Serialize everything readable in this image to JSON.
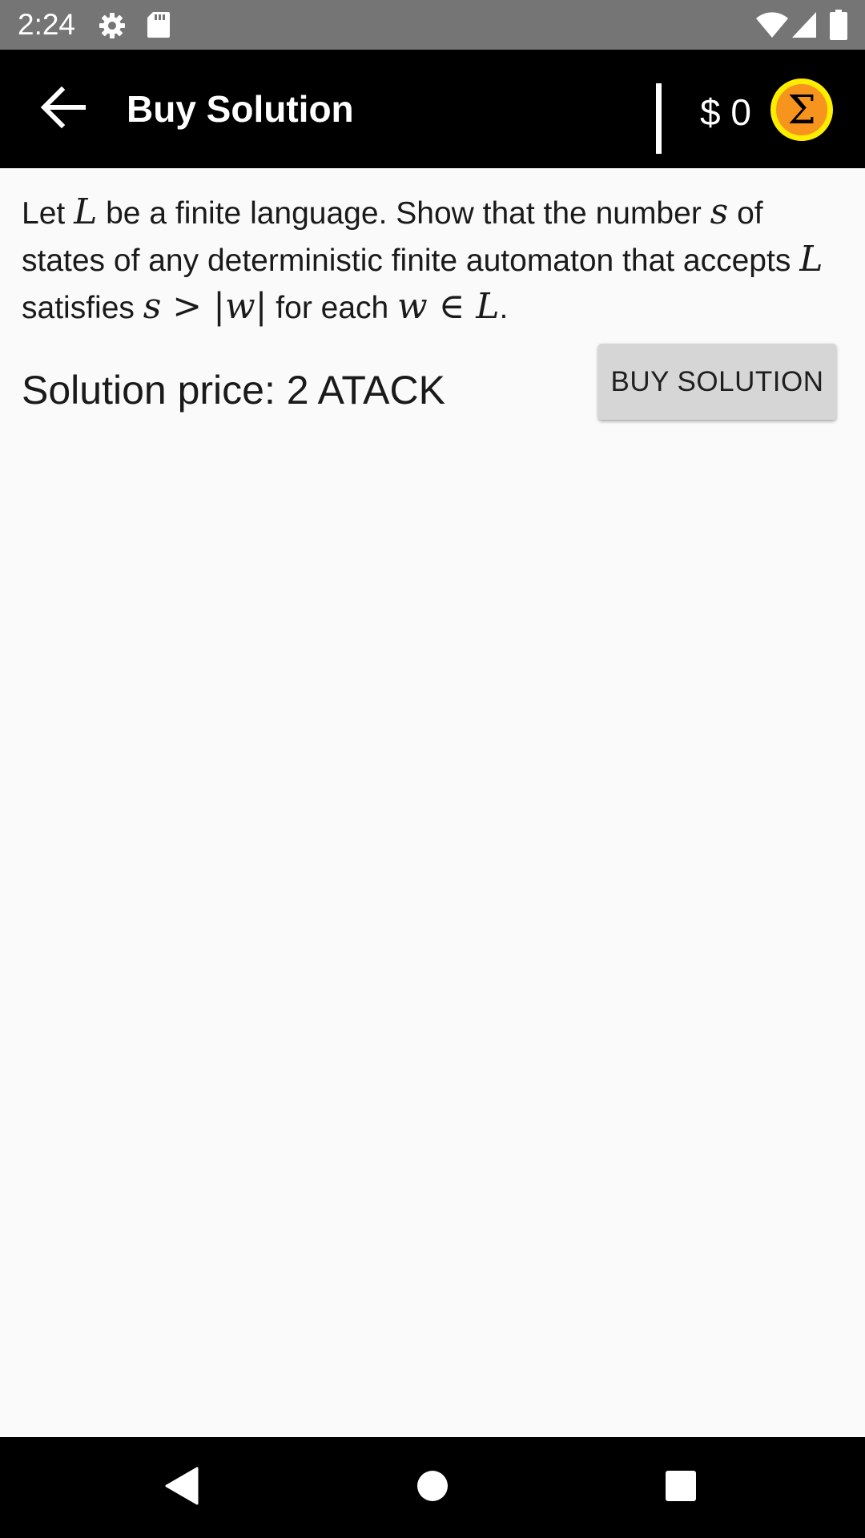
{
  "status_bar": {
    "time": "2:24",
    "icons": [
      "settings-icon",
      "sd-card-icon",
      "wifi-icon",
      "signal-icon",
      "battery-icon"
    ]
  },
  "app_bar": {
    "title": "Buy Solution",
    "balance": "$ 0",
    "back_icon": "arrow-left-icon",
    "sigma_symbol": "Σ",
    "colors": {
      "background": "#000000",
      "sigma_fill": "#f7941d",
      "sigma_ring": "#ffed00"
    }
  },
  "problem": {
    "segments": [
      {
        "t": "Let "
      },
      {
        "m": "L"
      },
      {
        "t": " be a finite language. Show that the number "
      },
      {
        "m": "s"
      },
      {
        "t": " of states of any deterministic finite automaton that accepts "
      },
      {
        "m": "L"
      },
      {
        "t": " satisfies "
      },
      {
        "m": "s > |w|"
      },
      {
        "t": " for each "
      },
      {
        "m": "w ∈ L"
      },
      {
        "t": "."
      }
    ]
  },
  "solution": {
    "price_text": "Solution price: 2 ATACK",
    "buy_button_label": "BUY SOLUTION"
  },
  "nav_bar": {
    "buttons": [
      "back-triangle-icon",
      "home-circle-icon",
      "recents-square-icon"
    ]
  }
}
